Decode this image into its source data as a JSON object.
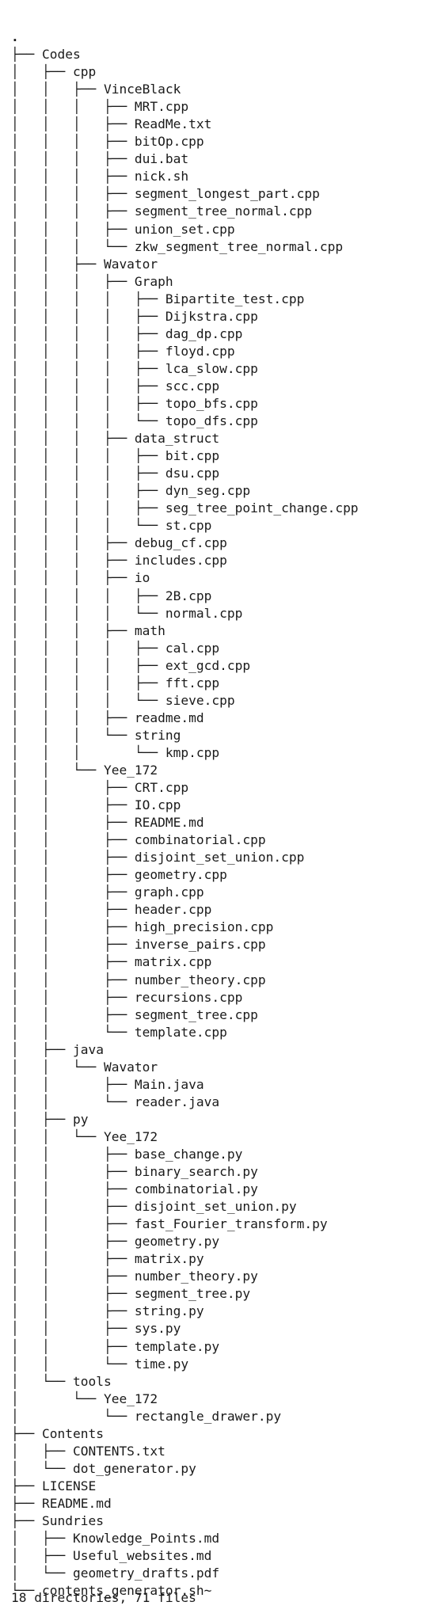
{
  "tree": {
    "lines": [
      ".",
      "├── Codes",
      "│   ├── cpp",
      "│   │   ├── VinceBlack",
      "│   │   │   ├── MRT.cpp",
      "│   │   │   ├── ReadMe.txt",
      "│   │   │   ├── bitOp.cpp",
      "│   │   │   ├── dui.bat",
      "│   │   │   ├── nick.sh",
      "│   │   │   ├── segment_longest_part.cpp",
      "│   │   │   ├── segment_tree_normal.cpp",
      "│   │   │   ├── union_set.cpp",
      "│   │   │   └── zkw_segment_tree_normal.cpp",
      "│   │   ├── Wavator",
      "│   │   │   ├── Graph",
      "│   │   │   │   ├── Bipartite_test.cpp",
      "│   │   │   │   ├── Dijkstra.cpp",
      "│   │   │   │   ├── dag_dp.cpp",
      "│   │   │   │   ├── floyd.cpp",
      "│   │   │   │   ├── lca_slow.cpp",
      "│   │   │   │   ├── scc.cpp",
      "│   │   │   │   ├── topo_bfs.cpp",
      "│   │   │   │   └── topo_dfs.cpp",
      "│   │   │   ├── data_struct",
      "│   │   │   │   ├── bit.cpp",
      "│   │   │   │   ├── dsu.cpp",
      "│   │   │   │   ├── dyn_seg.cpp",
      "│   │   │   │   ├── seg_tree_point_change.cpp",
      "│   │   │   │   └── st.cpp",
      "│   │   │   ├── debug_cf.cpp",
      "│   │   │   ├── includes.cpp",
      "│   │   │   ├── io",
      "│   │   │   │   ├── 2B.cpp",
      "│   │   │   │   └── normal.cpp",
      "│   │   │   ├── math",
      "│   │   │   │   ├── cal.cpp",
      "│   │   │   │   ├── ext_gcd.cpp",
      "│   │   │   │   ├── fft.cpp",
      "│   │   │   │   └── sieve.cpp",
      "│   │   │   ├── readme.md",
      "│   │   │   └── string",
      "│   │   │       └── kmp.cpp",
      "│   │   └── Yee_172",
      "│   │       ├── CRT.cpp",
      "│   │       ├── IO.cpp",
      "│   │       ├── README.md",
      "│   │       ├── combinatorial.cpp",
      "│   │       ├── disjoint_set_union.cpp",
      "│   │       ├── geometry.cpp",
      "│   │       ├── graph.cpp",
      "│   │       ├── header.cpp",
      "│   │       ├── high_precision.cpp",
      "│   │       ├── inverse_pairs.cpp",
      "│   │       ├── matrix.cpp",
      "│   │       ├── number_theory.cpp",
      "│   │       ├── recursions.cpp",
      "│   │       ├── segment_tree.cpp",
      "│   │       └── template.cpp",
      "│   ├── java",
      "│   │   └── Wavator",
      "│   │       ├── Main.java",
      "│   │       └── reader.java",
      "│   ├── py",
      "│   │   └── Yee_172",
      "│   │       ├── base_change.py",
      "│   │       ├── binary_search.py",
      "│   │       ├── combinatorial.py",
      "│   │       ├── disjoint_set_union.py",
      "│   │       ├── fast_Fourier_transform.py",
      "│   │       ├── geometry.py",
      "│   │       ├── matrix.py",
      "│   │       ├── number_theory.py",
      "│   │       ├── segment_tree.py",
      "│   │       ├── string.py",
      "│   │       ├── sys.py",
      "│   │       ├── template.py",
      "│   │       └── time.py",
      "│   └── tools",
      "│       └── Yee_172",
      "│           └── rectangle_drawer.py",
      "├── Contents",
      "│   ├── CONTENTS.txt",
      "│   └── dot_generator.py",
      "├── LICENSE",
      "├── README.md",
      "├── Sundries",
      "│   ├── Knowledge_Points.md",
      "│   ├── Useful_websites.md",
      "│   └── geometry_drafts.pdf",
      "└── contents_generator.sh~"
    ]
  },
  "summary": "18 directories, 71 files"
}
